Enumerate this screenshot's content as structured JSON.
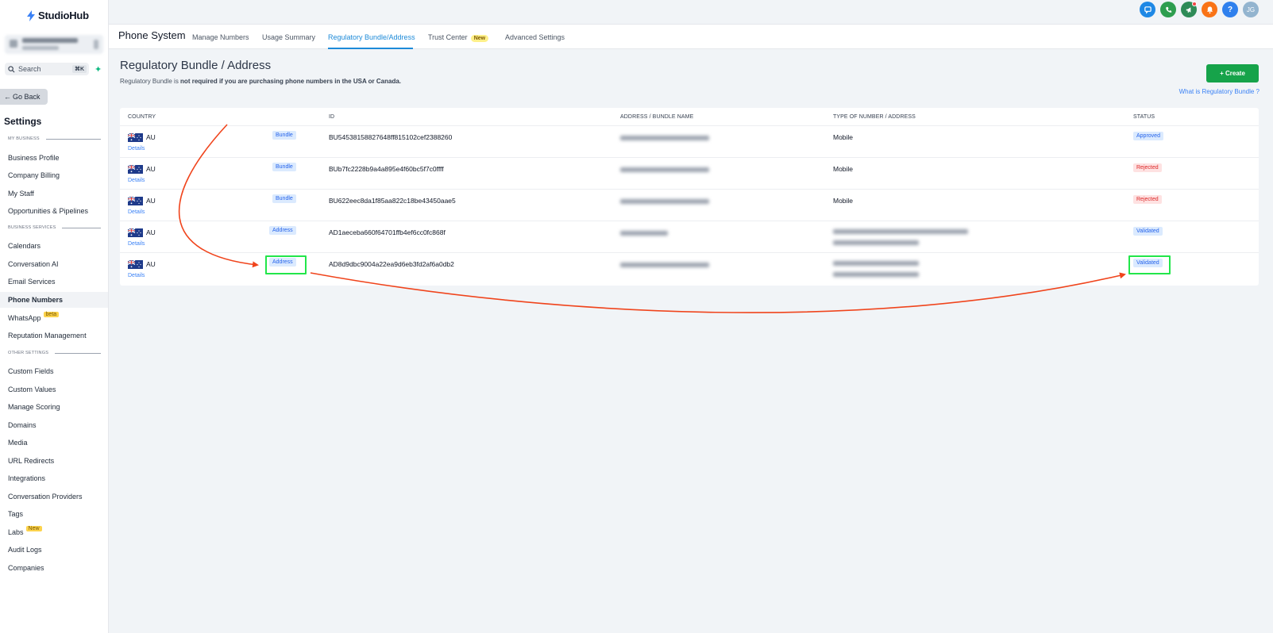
{
  "brand": {
    "name": "StudioHub"
  },
  "sidebar": {
    "search": {
      "placeholder": "Search",
      "shortcut": "⌘K"
    },
    "go_back": "Go Back",
    "settings_title": "Settings",
    "sections": [
      {
        "label": "MY BUSINESS",
        "items": [
          "Business Profile",
          "Company Billing",
          "My Staff",
          "Opportunities & Pipelines"
        ]
      },
      {
        "label": "BUSINESS SERVICES",
        "items": [
          "Calendars",
          "Conversation AI",
          "Email Services",
          "Phone Numbers",
          "WhatsApp",
          "Reputation Management"
        ]
      },
      {
        "label": "OTHER SETTINGS",
        "items": [
          "Custom Fields",
          "Custom Values",
          "Manage Scoring",
          "Domains",
          "Media",
          "URL Redirects",
          "Integrations",
          "Conversation Providers",
          "Tags",
          "Labs",
          "Audit Logs",
          "Companies"
        ]
      }
    ],
    "active_item": "Phone Numbers",
    "badges": {
      "whatsapp": "beta",
      "labs": "New"
    }
  },
  "topbar": {
    "avatar_initials": "JG",
    "help_label": "?",
    "icons": [
      "chat-icon",
      "phone-icon",
      "megaphone-icon",
      "bell-icon",
      "help-icon",
      "avatar"
    ],
    "colors": {
      "chat": "#1e88e5",
      "phone": "#2e9e4f",
      "megaphone": "#2e8b57",
      "bell": "#f97316",
      "help": "#2f80ed",
      "avatar": "#93b4cf"
    }
  },
  "tabs": {
    "title": "Phone System",
    "items": [
      "Manage Numbers",
      "Usage Summary",
      "Regulatory Bundle/Address",
      "Trust Center",
      "Advanced Settings"
    ],
    "active": "Regulatory Bundle/Address",
    "trust_center_badge": "New"
  },
  "page": {
    "title": "Regulatory Bundle / Address",
    "subtitle_prefix": "Regulatory Bundle is ",
    "subtitle_bold": "not required if you are purchasing phone numbers in the USA or Canada.",
    "create_button": "+ Create",
    "help_link": "What is Regulatory Bundle ?"
  },
  "table": {
    "columns": [
      "COUNTRY",
      "ID",
      "ADDRESS / BUNDLE NAME",
      "TYPE OF NUMBER / ADDRESS",
      "STATUS"
    ],
    "details_label": "Details",
    "rows": [
      {
        "country": "AU",
        "type": "Bundle",
        "id": "BU54538158827648ff815102cef2388260",
        "number_type": "Mobile",
        "status": "Approved"
      },
      {
        "country": "AU",
        "type": "Bundle",
        "id": "BUb7fc2228b9a4a895e4f60bc5f7c0ffff",
        "number_type": "Mobile",
        "status": "Rejected"
      },
      {
        "country": "AU",
        "type": "Bundle",
        "id": "BU622eec8da1f85aa822c18be43450aae5",
        "number_type": "Mobile",
        "status": "Rejected"
      },
      {
        "country": "AU",
        "type": "Address",
        "id": "AD1aeceba660f64701ffb4ef6cc0fc868f",
        "number_type": "",
        "status": "Validated"
      },
      {
        "country": "AU",
        "type": "Address",
        "id": "AD8d9dbc9004a22ea9d6eb3fd2af6a0db2",
        "number_type": "",
        "status": "Validated"
      }
    ]
  },
  "annotation": {
    "highlight_color": "#22e64a",
    "arrow_color": "#f0441c"
  }
}
